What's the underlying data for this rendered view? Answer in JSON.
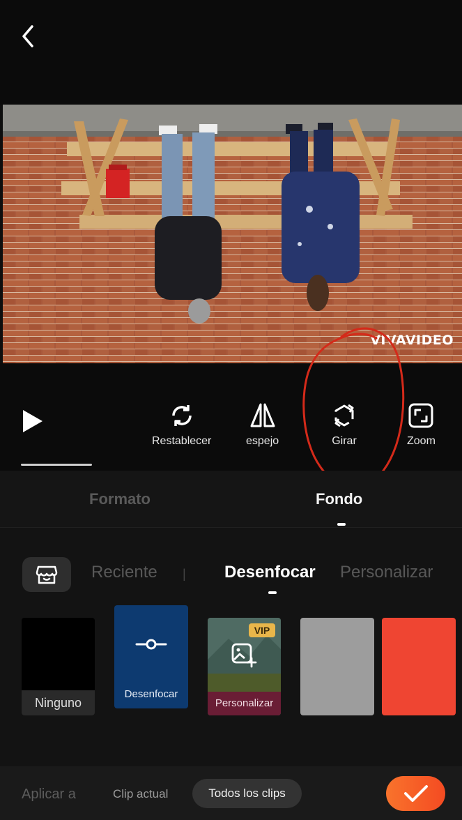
{
  "header": {
    "back_icon": "chevron-left-icon"
  },
  "preview": {
    "watermark": "VIVAVIDEO"
  },
  "toolbar": {
    "play_icon": "play-icon",
    "tools": [
      {
        "label": "Restablecer",
        "icon": "reset-icon"
      },
      {
        "label": "espejo",
        "icon": "mirror-icon"
      },
      {
        "label": "Girar",
        "icon": "rotate-icon"
      },
      {
        "label": "Zoom",
        "icon": "zoom-icon"
      }
    ]
  },
  "tabs": {
    "formato": "Formato",
    "fondo": "Fondo",
    "active": "Fondo"
  },
  "categories": {
    "store_icon": "store-icon",
    "items": [
      "Reciente",
      "Desenfocar",
      "Personalizar"
    ],
    "active": "Desenfocar"
  },
  "backgrounds": {
    "ninguno": "Ninguno",
    "desenfocar": "Desenfocar",
    "personalizar": "Personalizar",
    "vip_badge": "VIP",
    "gray_color": "#9d9d9d",
    "red_color": "#ef4532"
  },
  "bottom": {
    "apply_label": "Aplicar a",
    "clip_actual": "Clip actual",
    "todos_clips": "Todos los clips",
    "confirm_icon": "checkmark-icon"
  },
  "colors": {
    "accent": "#f9732c",
    "annotation": "#d42a1a"
  }
}
